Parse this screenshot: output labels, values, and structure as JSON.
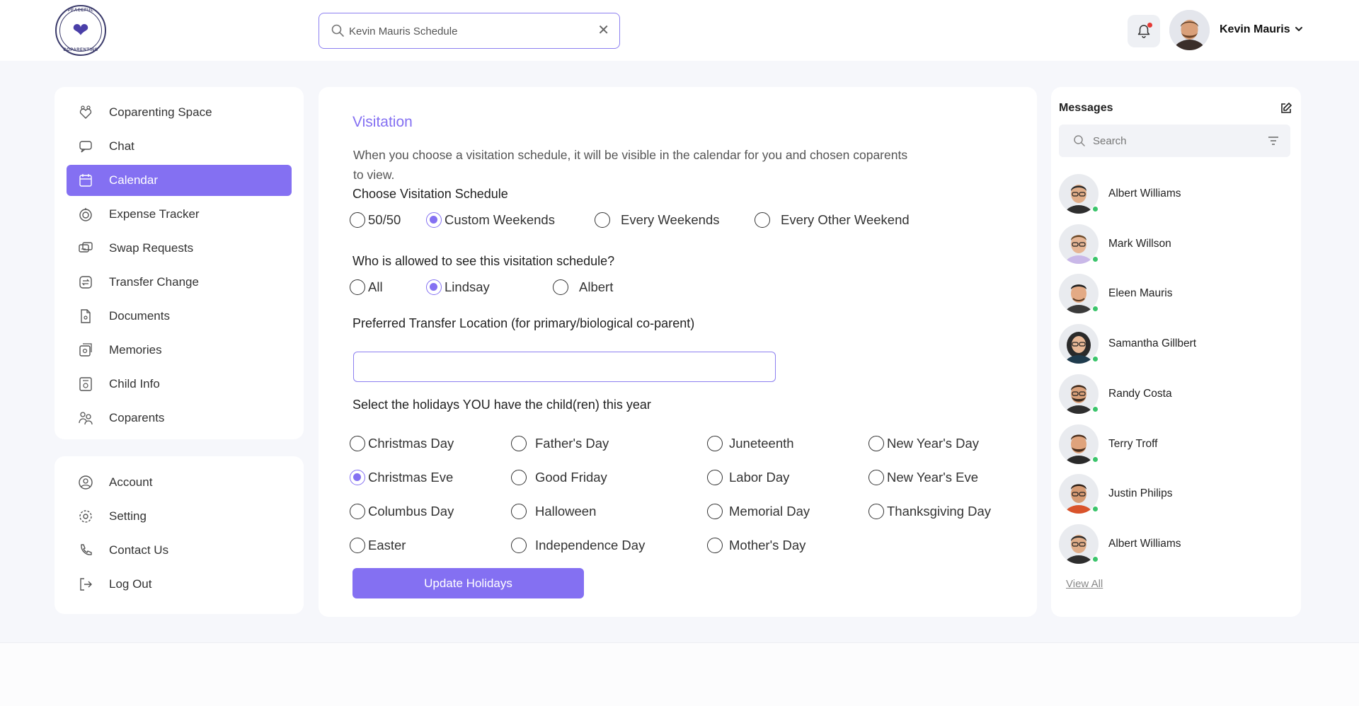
{
  "header": {
    "logo_text_top": "PEACEFUL",
    "logo_text_bottom": "COPARENTING",
    "search_value": "Kevin Mauris Schedule",
    "user_name": "Kevin Mauris"
  },
  "nav": {
    "main": [
      {
        "label": "Coparenting Space",
        "icon": "coparenting-icon",
        "active": false
      },
      {
        "label": "Chat",
        "icon": "chat-icon",
        "active": false
      },
      {
        "label": "Calendar",
        "icon": "calendar-icon",
        "active": true
      },
      {
        "label": "Expense Tracker",
        "icon": "expense-icon",
        "active": false
      },
      {
        "label": "Swap Requests",
        "icon": "swap-icon",
        "active": false
      },
      {
        "label": "Transfer Change",
        "icon": "transfer-icon",
        "active": false
      },
      {
        "label": "Documents",
        "icon": "document-icon",
        "active": false
      },
      {
        "label": "Memories",
        "icon": "memories-icon",
        "active": false
      },
      {
        "label": "Child Info",
        "icon": "child-info-icon",
        "active": false
      },
      {
        "label": "Coparents",
        "icon": "coparents-icon",
        "active": false
      }
    ],
    "secondary": [
      {
        "label": "Account",
        "icon": "account-icon"
      },
      {
        "label": "Setting",
        "icon": "gear-icon"
      },
      {
        "label": "Contact Us",
        "icon": "phone-icon"
      },
      {
        "label": "Log Out",
        "icon": "logout-icon"
      }
    ]
  },
  "main": {
    "title": "Visitation",
    "description": "When you choose a visitation schedule, it will be visible in the calendar for you and chosen coparents to view.",
    "schedule_label": "Choose Visitation Schedule",
    "schedule_options": [
      "50/50",
      "Custom Weekends",
      "Every Weekends",
      "Every Other Weekend"
    ],
    "schedule_selected": "Custom Weekends",
    "visibility_label": "Who is allowed to see this visitation schedule?",
    "visibility_options": [
      "All",
      "Lindsay",
      "Albert"
    ],
    "visibility_selected": "Lindsay",
    "location_label": "Preferred Transfer Location (for primary/biological co-parent)",
    "location_value": "",
    "holidays_label": "Select the holidays YOU have the child(ren) this year",
    "holidays": [
      [
        "Christmas Day",
        "Father's Day",
        "Juneteenth",
        "New Year's Day"
      ],
      [
        "Christmas Eve",
        "Good Friday",
        "Labor Day",
        "New Year's Eve"
      ],
      [
        "Columbus Day",
        "Halloween",
        "Memorial Day",
        "Thanksgiving Day"
      ],
      [
        "Easter",
        "Independence Day",
        "Mother's Day"
      ]
    ],
    "holidays_selected": [
      "Christmas Eve"
    ],
    "update_button": "Update Holidays"
  },
  "messages": {
    "title": "Messages",
    "search_placeholder": "Search",
    "contacts": [
      {
        "name": "Albert Williams",
        "online": true
      },
      {
        "name": "Mark Willson",
        "online": true
      },
      {
        "name": "Eleen Mauris",
        "online": true
      },
      {
        "name": "Samantha Gillbert",
        "online": true
      },
      {
        "name": "Randy Costa",
        "online": true
      },
      {
        "name": "Terry Troff",
        "online": true
      },
      {
        "name": "Justin Philips",
        "online": true
      },
      {
        "name": "Albert Williams",
        "online": true
      }
    ],
    "view_all": "View All"
  },
  "colors": {
    "accent": "#8470f2",
    "online": "#3bc46b",
    "notification": "#e53935"
  }
}
